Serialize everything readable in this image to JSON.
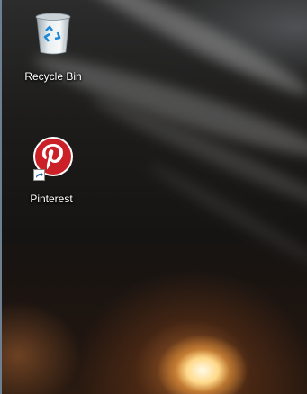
{
  "desktop": {
    "icons": [
      {
        "id": "recycle-bin",
        "label": "Recycle Bin",
        "icon": "recycle-bin-icon"
      },
      {
        "id": "pinterest",
        "label": "Pinterest",
        "icon": "pinterest-icon",
        "shortcut": true,
        "brand_color": "#cb2027"
      }
    ]
  }
}
